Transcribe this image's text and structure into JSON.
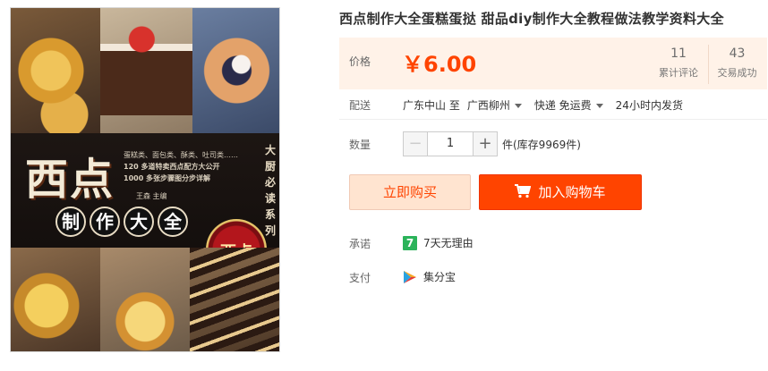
{
  "cover": {
    "title": "西点",
    "subtitle_line1": "蛋糕类、面包类、酥类、吐司类……",
    "subtitle_line2": "120 多道特卖西点配方大公开",
    "subtitle_line3": "1000 多张步骤图分步详解",
    "author": "王森 主编",
    "circle_chars": [
      "制",
      "作",
      "大",
      "全"
    ],
    "series": "大厨必读系列",
    "badge": "西点"
  },
  "product": {
    "title": "西点制作大全蛋糕蛋挞 甜品diy制作大全教程做法教学资料大全",
    "price_label": "价格",
    "price": "￥6.00",
    "reviews_count": "11",
    "reviews_label": "累计评论",
    "deals_count": "43",
    "deals_label": "交易成功"
  },
  "shipping": {
    "label": "配送",
    "from_to": "广东中山 至",
    "destination": "广西柳州",
    "method": "快递 免运费",
    "dispatch": "24小时内发货"
  },
  "quantity": {
    "label": "数量",
    "minus": "−",
    "value": "1",
    "plus": "+",
    "stock": "件(库存9969件)"
  },
  "actions": {
    "buy_now": "立即购买",
    "add_to_cart": "加入购物车"
  },
  "promise": {
    "label": "承诺",
    "icon_text": "7",
    "text": "7天无理由"
  },
  "payment": {
    "label": "支付",
    "text": "集分宝"
  },
  "colors": {
    "accent": "#ff4400",
    "price_bg": "#fff2e8",
    "buy_bg": "#ffe4d0",
    "promise_green": "#2bb35a"
  }
}
